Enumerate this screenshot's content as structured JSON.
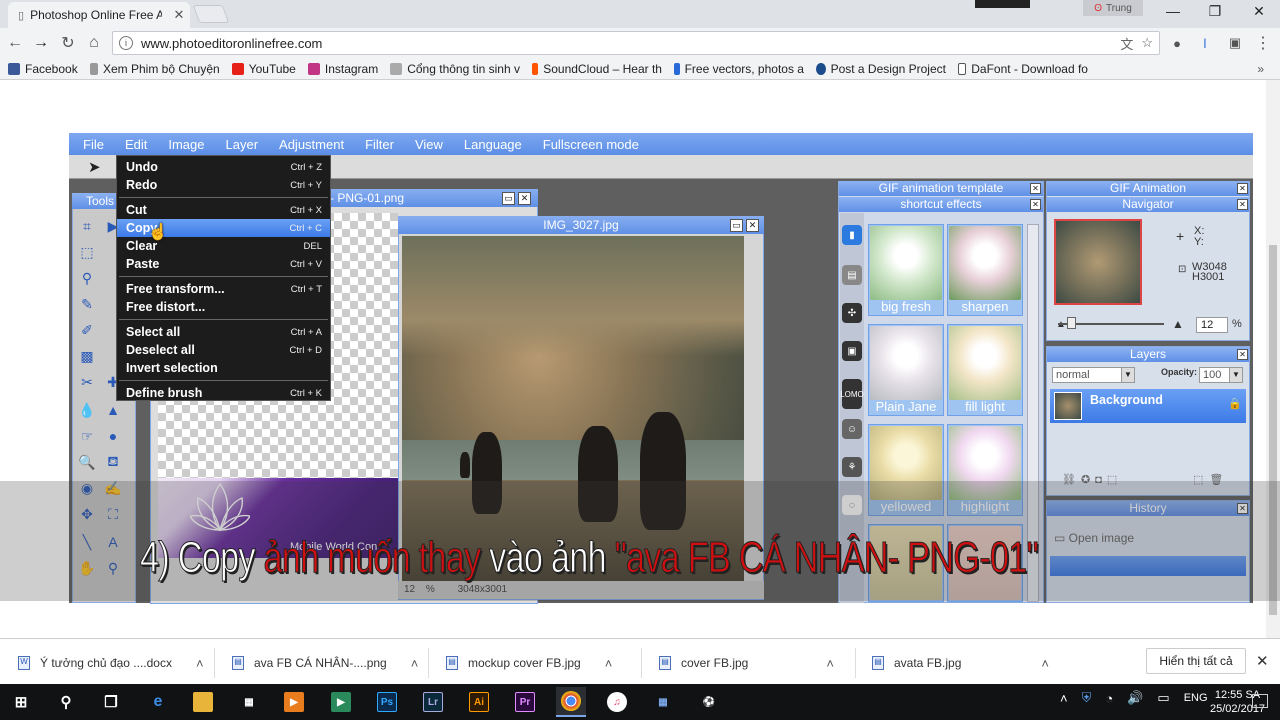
{
  "browser": {
    "tab_title": "Photoshop Online Free A",
    "url": "www.photoeditoronlinefree.com",
    "profile_name": "Trung",
    "bookmarks": [
      "Facebook",
      "Xem Phim bộ Chuyện",
      "YouTube",
      "Instagram",
      "Cổng thông tin sinh v",
      "SoundCloud – Hear th",
      "Free vectors, photos a",
      "Post a Design Project",
      "DaFont - Download fo"
    ]
  },
  "editor": {
    "menu": [
      "File",
      "Edit",
      "Image",
      "Layer",
      "Adjustment",
      "Filter",
      "View",
      "Language",
      "Fullscreen mode"
    ],
    "tools_title": "Tools",
    "docA_title": "- PNG-01.png",
    "docA_watermark": "Mobile World Con",
    "docB_title": "IMG_3027.jpg",
    "docB_zoom": "12",
    "docB_zoom_unit": "%",
    "docB_size": "3048x3001",
    "edit_menu": [
      {
        "label": "Undo",
        "key": "Ctrl + Z"
      },
      {
        "label": "Redo",
        "key": "Ctrl + Y"
      },
      {
        "label": "Cut",
        "key": "Ctrl + X"
      },
      {
        "label": "Copy",
        "key": "Ctrl + C"
      },
      {
        "label": "Clear",
        "key": "DEL"
      },
      {
        "label": "Paste",
        "key": "Ctrl + V"
      },
      {
        "label": "Free transform...",
        "key": "Ctrl + T"
      },
      {
        "label": "Free distort...",
        "key": ""
      },
      {
        "label": "Select all",
        "key": "Ctrl + A"
      },
      {
        "label": "Deselect all",
        "key": "Ctrl + D"
      },
      {
        "label": "Invert selection",
        "key": ""
      },
      {
        "label": "Define brush",
        "key": "Ctrl + K"
      }
    ],
    "gif_panel_title": "GIF animation template",
    "effects_title": "shortcut effects",
    "effects": [
      "big fresh",
      "sharpen",
      "Plain Jane",
      "fill light",
      "yellowed",
      "highlight"
    ],
    "nav_panel_title": "GIF Animation",
    "navigator_title": "Navigator",
    "nav_x": "X:",
    "nav_y": "Y:",
    "nav_w": "W3048",
    "nav_h": "H3001",
    "nav_zoom": "12",
    "nav_zoom_unit": "%",
    "layers_title": "Layers",
    "blend_mode": "normal",
    "opacity_label": "Opacity:",
    "opacity_value": "100",
    "layer_name": "Background",
    "history_title": "History",
    "history_item": "Open image"
  },
  "caption": {
    "part1": "4) Copy ",
    "part2": "ảnh muốn thay",
    "part3": " vào ảnh ",
    "part4": "\"ava FB CÁ NHÂN- PNG-01\""
  },
  "downloads": {
    "items": [
      "Ý tưởng chủ đạo ....docx",
      "ava FB CÁ NHÂN-....png",
      "mockup cover FB.jpg",
      "cover FB.jpg",
      "avata FB.jpg"
    ],
    "show_all": "Hiển thị tất cả"
  },
  "taskbar": {
    "lang": "ENG",
    "time": "12:55 SA",
    "date": "25/02/2017"
  }
}
